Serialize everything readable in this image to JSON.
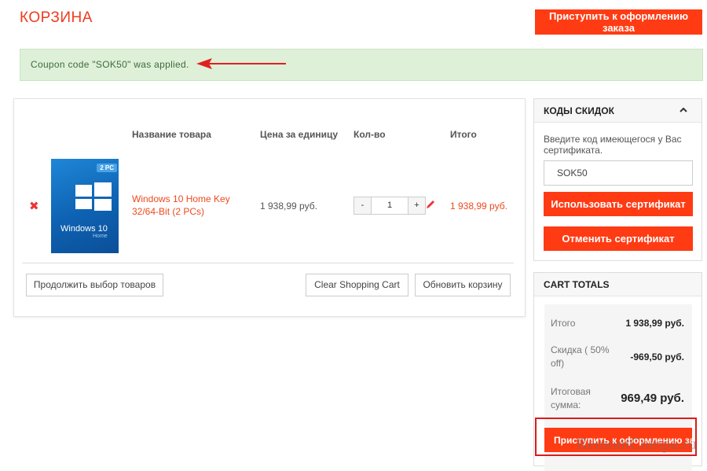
{
  "page": {
    "title": "КОРЗИНА",
    "checkout_top_label": "Приступить к оформлению заказа"
  },
  "notice": {
    "text": "Coupon code \"SOK50\" was applied.",
    "arrow_color": "#e02020"
  },
  "cart": {
    "headers": {
      "name": "Название товара",
      "price": "Цена за единицу",
      "qty": "Кол-во",
      "total": "Итого"
    },
    "item": {
      "image_badge": "2 PC",
      "image_title": "Windows 10",
      "image_subtitle": "Home",
      "name": "Windows 10 Home Key 32/64-Bit (2 PCs)",
      "unit_price": "1 938,99 руб.",
      "qty_minus": "-",
      "qty_value": "1",
      "qty_plus": "+",
      "row_total": "1 938,99 руб."
    },
    "continue_label": "Продолжить выбор товаров",
    "clear_label": "Clear Shopping Cart",
    "update_label": "Обновить корзину"
  },
  "coupon_panel": {
    "title": "КОДЫ СКИДОК",
    "hint": "Введите код имеющегося у Вас сертификата.",
    "input_value": "SOK50",
    "apply_label": "Использовать сертификат",
    "cancel_label": "Отменить сертификат"
  },
  "totals": {
    "title": "CART TOTALS",
    "subtotal_label": "Итого",
    "subtotal_value": "1 938,99 руб.",
    "discount_label": "Скидка ( 50% off)",
    "discount_value": "-969,50 руб.",
    "grand_label": "Итоговая сумма:",
    "grand_value": "969,49 руб.",
    "checkout_label": "Приступить к оформлению заказа"
  },
  "watermark": "RemontCompa.ru",
  "colors": {
    "accent": "#ff3b14",
    "title": "#ee3b1e",
    "success_bg": "#dff0d8",
    "highlight_frame": "#d91c1c"
  }
}
